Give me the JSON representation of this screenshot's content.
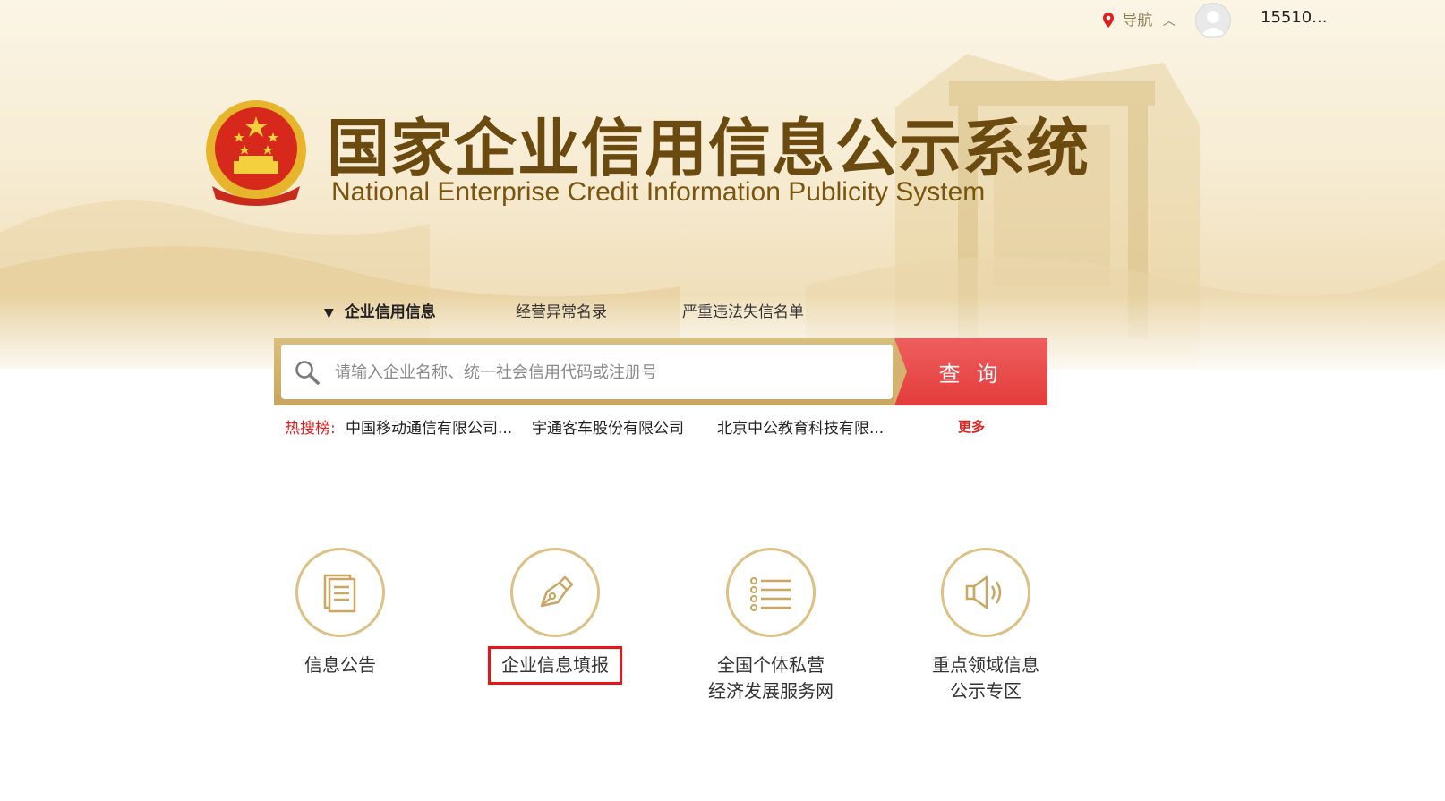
{
  "topbar": {
    "nav_label": "导航",
    "username": "15510..."
  },
  "header": {
    "title": "国家企业信用信息公示系统",
    "subtitle": "National Enterprise Credit Information Publicity System"
  },
  "tabs": [
    {
      "label": "企业信用信息",
      "active": true
    },
    {
      "label": "经营异常名录",
      "active": false
    },
    {
      "label": "严重违法失信名单",
      "active": false
    }
  ],
  "search": {
    "placeholder": "请输入企业名称、统一社会信用代码或注册号",
    "button_label": "查询"
  },
  "hot": {
    "label": "热搜榜:",
    "items": [
      "中国移动通信有限公司...",
      "宇通客车股份有限公司",
      "北京中公教育科技有限..."
    ],
    "more_label": "更多"
  },
  "services": [
    {
      "line1": "信息公告",
      "line2": "",
      "icon": "document-icon"
    },
    {
      "line1": "企业信息填报",
      "line2": "",
      "icon": "pen-icon",
      "highlighted": true
    },
    {
      "line1": "全国个体私营",
      "line2": "经济发展服务网",
      "icon": "list-icon"
    },
    {
      "line1": "重点领域信息",
      "line2": "公示专区",
      "icon": "speaker-icon"
    }
  ],
  "colors": {
    "accent_gold": "#dcc084",
    "title_brown": "#6b4a10",
    "search_red": "#e43c3c",
    "highlight_red": "#e8141a"
  }
}
